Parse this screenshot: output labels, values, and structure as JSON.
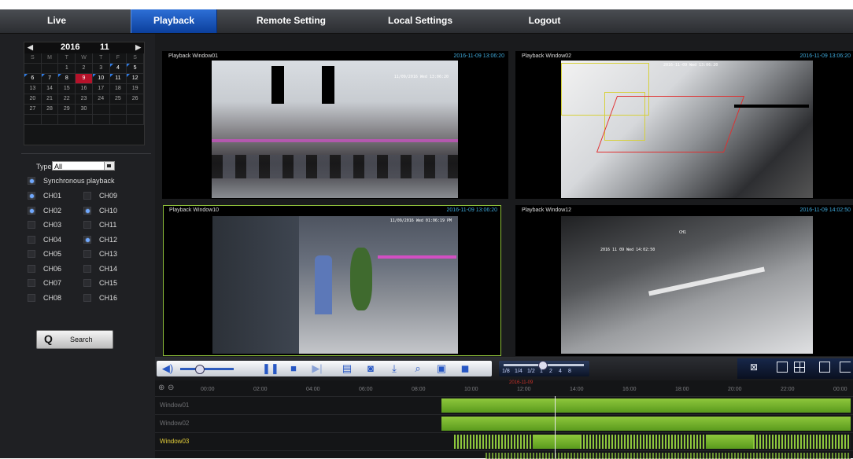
{
  "nav": {
    "tabs": [
      {
        "label": "Live"
      },
      {
        "label": "Playback",
        "active": true
      },
      {
        "label": "Remote Setting"
      },
      {
        "label": "Local Settings"
      },
      {
        "label": "Logout"
      }
    ]
  },
  "calendar": {
    "prev_icon": "triangle-left-icon",
    "next_icon": "triangle-right-icon",
    "year": "2016",
    "month": "11",
    "weekdays": [
      "S",
      "M",
      "T",
      "W",
      "T",
      "F",
      "S"
    ],
    "weeks": [
      [
        "",
        "",
        "1",
        "2",
        "3",
        "4",
        "5"
      ],
      [
        "6",
        "7",
        "8",
        "9",
        "10",
        "11",
        "12"
      ],
      [
        "13",
        "14",
        "15",
        "16",
        "17",
        "18",
        "19"
      ],
      [
        "20",
        "21",
        "22",
        "23",
        "24",
        "25",
        "26"
      ],
      [
        "27",
        "28",
        "29",
        "30",
        "",
        "",
        ""
      ],
      [
        "",
        "",
        "",
        "",
        "",
        "",
        ""
      ]
    ],
    "selected_day": "9",
    "record_days": [
      "4",
      "5",
      "6",
      "7",
      "8",
      "10",
      "11",
      "12"
    ]
  },
  "filter": {
    "type_label": "Type",
    "type_value": "All",
    "sync_label": "Synchronous playback",
    "channels": [
      {
        "label": "CH01",
        "checked": true
      },
      {
        "label": "CH09",
        "checked": false
      },
      {
        "label": "CH02",
        "checked": true
      },
      {
        "label": "CH10",
        "checked": true
      },
      {
        "label": "CH03",
        "checked": false
      },
      {
        "label": "CH11",
        "checked": false
      },
      {
        "label": "CH04",
        "checked": false
      },
      {
        "label": "CH12",
        "checked": true
      },
      {
        "label": "CH05",
        "checked": false
      },
      {
        "label": "CH13",
        "checked": false
      },
      {
        "label": "CH06",
        "checked": false
      },
      {
        "label": "CH14",
        "checked": false
      },
      {
        "label": "CH07",
        "checked": false
      },
      {
        "label": "CH15",
        "checked": false
      },
      {
        "label": "CH08",
        "checked": false
      },
      {
        "label": "CH16",
        "checked": false
      }
    ],
    "search_label": "Search",
    "search_icon": "magnifier-icon"
  },
  "windows": [
    {
      "title": "Playback Window01",
      "time": "2016-11-09 13:06:20",
      "osd": "11/09/2016 Wed 13:06:20",
      "selected": false
    },
    {
      "title": "Playback Window02",
      "time": "2016-11-09 13:06:20",
      "osd": "2016-11-09 Wed 13:06:20",
      "selected": false
    },
    {
      "title": "Playback Window10",
      "time": "2016-11-09 13:06:20",
      "osd": "11/09/2016 Wed 01:06:19 PM",
      "selected": true
    },
    {
      "title": "Playback Window12",
      "time": "2016-11-09 14:02:50",
      "osd": "2016 11 09 Wed 14:02:50",
      "osd2": "CH1",
      "selected": false
    }
  ],
  "controls": {
    "icons": [
      "volume-icon",
      "pause-icon",
      "stop-icon",
      "step-forward-icon",
      "clip-icon",
      "snapshot-icon",
      "download-icon",
      "zoom-icon",
      "play-file-icon",
      "fullscreen-icon"
    ],
    "speeds": [
      "1/8",
      "1/4",
      "1/2",
      "1",
      "2",
      "4",
      "8"
    ],
    "volume_level": 0.35,
    "speed_selected": "1",
    "layout_icons": [
      "layout-toggle-icon",
      "layout-1-icon",
      "layout-4-icon",
      "layout-exit-icon",
      "layout-9-icon"
    ]
  },
  "timeline": {
    "zoom_in_icon": "zoom-in-icon",
    "zoom_out_icon": "zoom-out-icon",
    "ticks": [
      "00:00",
      "02:00",
      "04:00",
      "06:00",
      "08:00",
      "10:00",
      "12:00",
      "14:00",
      "16:00",
      "18:00",
      "20:00",
      "22:00",
      "00:00"
    ],
    "current_date": "2016-11-09",
    "rows": [
      {
        "label": "Window01",
        "active": false
      },
      {
        "label": "Window02",
        "active": false
      },
      {
        "label": "Window03",
        "active": true
      }
    ]
  }
}
